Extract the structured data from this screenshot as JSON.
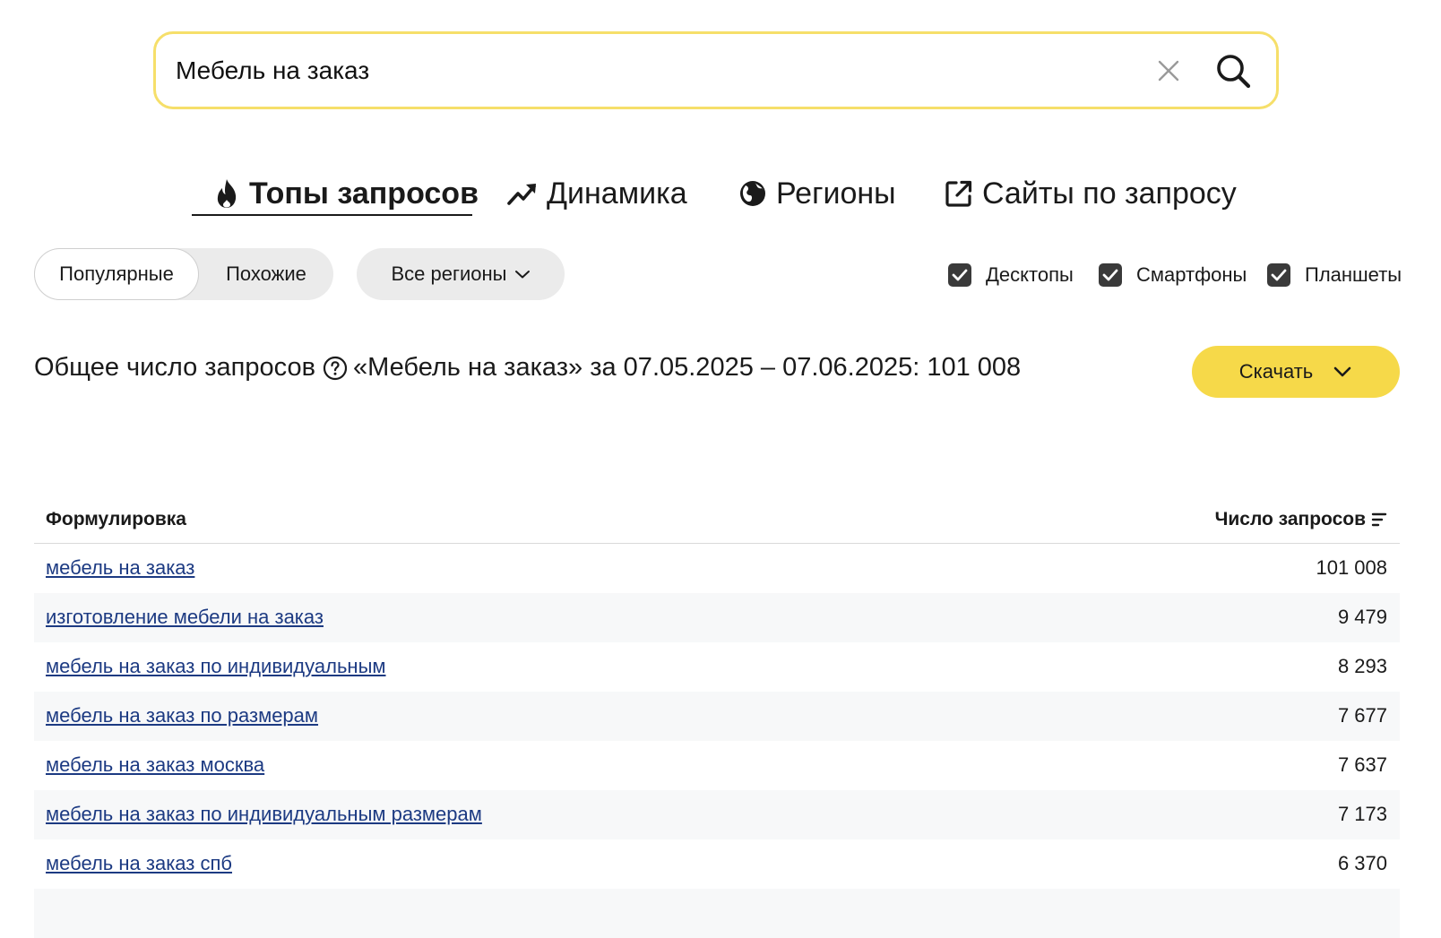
{
  "search": {
    "value": "Мебель на заказ",
    "clear_icon": "close-icon",
    "search_icon": "search-icon",
    "accent_color": "#f6df6a"
  },
  "tabs": [
    {
      "label": "Топы запросов",
      "icon": "fire-icon",
      "active": true
    },
    {
      "label": "Динамика",
      "icon": "trend-up-icon",
      "active": false
    },
    {
      "label": "Регионы",
      "icon": "globe-icon",
      "active": false
    },
    {
      "label": "Сайты по запросу",
      "icon": "external-link-icon",
      "active": false
    }
  ],
  "filters": {
    "mode_popular": "Популярные",
    "mode_similar": "Похожие",
    "region": "Все регионы",
    "devices": [
      {
        "label": "Десктопы",
        "checked": true
      },
      {
        "label": "Смартфоны",
        "checked": true
      },
      {
        "label": "Планшеты",
        "checked": true
      }
    ]
  },
  "summary": {
    "prefix": "Общее число запросов",
    "text": "«Мебель на заказ» за 07.05.2025 – 07.06.2025: 101 008",
    "download_label": "Скачать",
    "download_color": "#f6d949"
  },
  "table": {
    "col_phrase": "Формулировка",
    "col_count": "Число запросов",
    "rows": [
      {
        "phrase": "мебель на заказ",
        "count": "101 008"
      },
      {
        "phrase": "изготовление мебели на заказ",
        "count": "9 479"
      },
      {
        "phrase": "мебель на заказ по индивидуальным",
        "count": "8 293"
      },
      {
        "phrase": "мебель на заказ по размерам",
        "count": "7 677"
      },
      {
        "phrase": "мебель на заказ москва",
        "count": "7 637"
      },
      {
        "phrase": "мебель на заказ по индивидуальным размерам",
        "count": "7 173"
      },
      {
        "phrase": "мебель на заказ спб",
        "count": "6 370"
      }
    ]
  }
}
